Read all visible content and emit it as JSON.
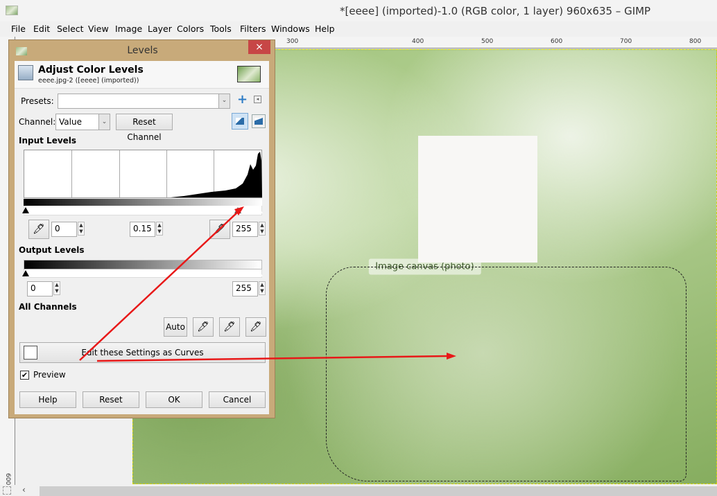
{
  "window": {
    "title": "*[eeee] (imported)-1.0 (RGB color, 1 layer) 960x635 – GIMP",
    "app_icon": "gimp-image-icon"
  },
  "menubar": [
    "File",
    "Edit",
    "Select",
    "View",
    "Image",
    "Layer",
    "Colors",
    "Tools",
    "Filters",
    "Windows",
    "Help"
  ],
  "ruler": {
    "horizontal_labels": [
      "300",
      "400",
      "500",
      "600",
      "700",
      "800"
    ],
    "vertical_labels": [
      "600"
    ]
  },
  "canvas": {
    "placeholder_label": "Image canvas (photo)",
    "selection": "active"
  },
  "dialog": {
    "title": "Levels",
    "close_label": "×",
    "header_title": "Adjust Color Levels",
    "header_subtitle": "eeee.jpg-2 ([eeee] (imported))",
    "presets_label": "Presets:",
    "presets_value": "",
    "channel_label": "Channel:",
    "channel_value": "Value",
    "reset_channel_label": "Reset Channel",
    "input_levels_label": "Input Levels",
    "input_low": "0",
    "input_gamma": "0.15",
    "input_high": "255",
    "output_levels_label": "Output Levels",
    "output_low": "0",
    "output_high": "255",
    "all_channels_label": "All Channels",
    "auto_label": "Auto",
    "curves_label": "Edit these Settings as Curves",
    "preview_label": "Preview",
    "preview_checked": true,
    "buttons": {
      "help": "Help",
      "reset": "Reset",
      "ok": "OK",
      "cancel": "Cancel"
    }
  },
  "annotations": {
    "arrow_color": "#e81818"
  },
  "colors": {
    "dialog_frame": "#c8aa7a",
    "close_button": "#c74646"
  }
}
